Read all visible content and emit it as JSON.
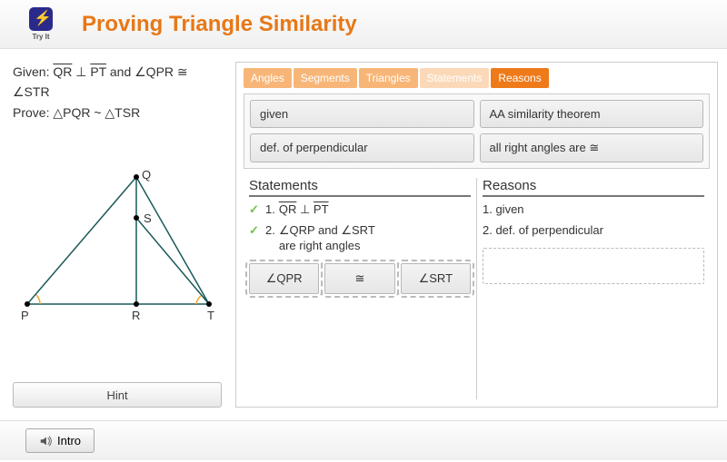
{
  "header": {
    "tryit_label": "Try It",
    "title": "Proving Triangle Similarity"
  },
  "problem": {
    "given_label": "Given:",
    "given_text_html": "QR ⊥ PT and ∠QPR ≅ ∠STR",
    "prove_label": "Prove:",
    "prove_text": "△PQR ~ △TSR"
  },
  "diagram": {
    "points": {
      "P": "P",
      "Q": "Q",
      "R": "R",
      "S": "S",
      "T": "T"
    }
  },
  "tabs": {
    "angles": "Angles",
    "segments": "Segments",
    "triangles": "Triangles",
    "statements": "Statements",
    "reasons": "Reasons"
  },
  "tiles": {
    "given": "given",
    "aa": "AA similarity theorem",
    "defperp": "def. of perpendicular",
    "allright": "all right angles are ≅"
  },
  "proof": {
    "statements_head": "Statements",
    "reasons_head": "Reasons",
    "s1": "QR ⊥ PT",
    "s2a": "∠QRP and ∠SRT",
    "s2b": "are right angles",
    "r1": "1. given",
    "r2": "2. def. of perpendicular",
    "drag_qpr": "∠QPR",
    "drag_cong": "≅",
    "drag_srt": "∠SRT"
  },
  "buttons": {
    "hint": "Hint",
    "intro": "Intro"
  }
}
